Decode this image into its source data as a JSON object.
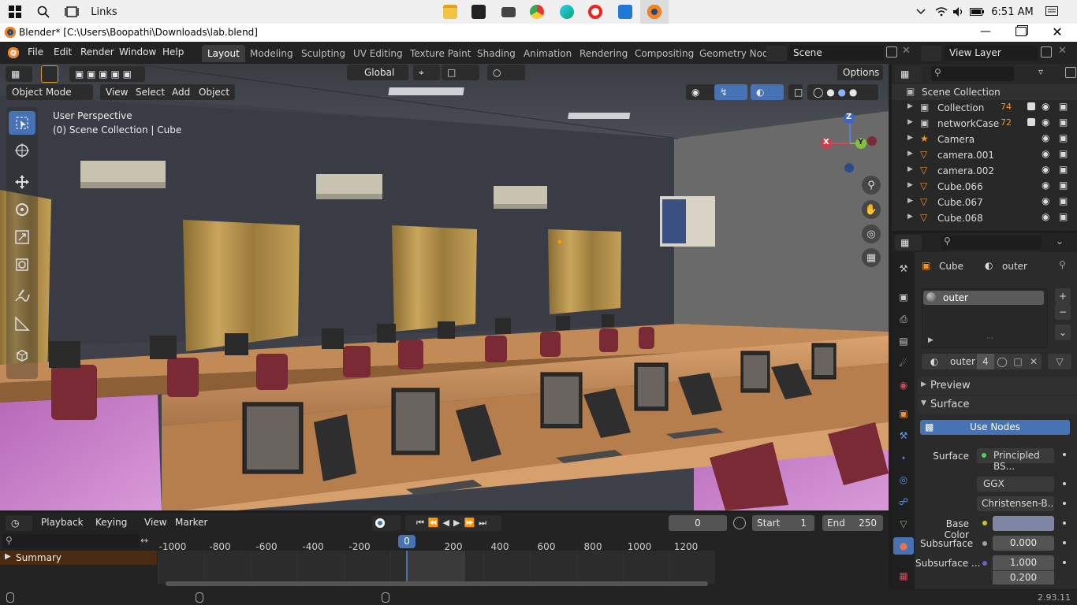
{
  "taskbar": {
    "links_label": "Links",
    "time": "6:51 AM"
  },
  "window": {
    "title": "Blender* [C:\\Users\\Boopathi\\Downloads\\lab.blend]"
  },
  "menu": {
    "file": "File",
    "edit": "Edit",
    "render": "Render",
    "window": "Window",
    "help": "Help"
  },
  "workspaces": [
    "Layout",
    "Modeling",
    "Sculpting",
    "UV Editing",
    "Texture Paint",
    "Shading",
    "Animation",
    "Rendering",
    "Compositing",
    "Geometry Nod"
  ],
  "scene": {
    "scene_name": "Scene",
    "view_layer": "View Layer"
  },
  "viewport": {
    "transform_orientation": "Global",
    "options_label": "Options",
    "mode": "Object Mode",
    "view": "View",
    "select": "Select",
    "add": "Add",
    "object": "Object",
    "perspective_label": "User Perspective",
    "context_label": "(0) Scene Collection | Cube",
    "gizmo": {
      "x": "X",
      "y": "Y",
      "z": "Z"
    }
  },
  "timeline": {
    "playback": "Playback",
    "keying": "Keying",
    "view": "View",
    "marker": "Marker",
    "current_frame": "0",
    "start_label": "Start",
    "start_value": "1",
    "end_label": "End",
    "end_value": "250",
    "ticks": [
      "-1000",
      "-800",
      "-600",
      "-400",
      "-200",
      "0",
      "200",
      "400",
      "600",
      "800",
      "1000",
      "1200"
    ],
    "playhead": "0",
    "summary": "Summary"
  },
  "outliner": {
    "root": "Scene Collection",
    "items": [
      {
        "name": "Collection",
        "badge": "74"
      },
      {
        "name": "networkCase",
        "badge": "72"
      },
      {
        "name": "Camera",
        "badge": ""
      },
      {
        "name": "camera.001",
        "badge": ""
      },
      {
        "name": "camera.002",
        "badge": ""
      },
      {
        "name": "Cube.066",
        "badge": ""
      },
      {
        "name": "Cube.067",
        "badge": ""
      },
      {
        "name": "Cube.068",
        "badge": ""
      }
    ]
  },
  "properties": {
    "object_name": "Cube",
    "material_name": "outer",
    "slot_name": "outer",
    "material_field": "outer",
    "user_count": "4",
    "preview_label": "Preview",
    "surface_label": "Surface",
    "use_nodes": "Use Nodes",
    "surface_field_label": "Surface",
    "surface_value": "Principled BS...",
    "distribution": "GGX",
    "subsurface_method": "Christensen-B...",
    "base_color_label": "Base Color",
    "base_color": "#7f86a3",
    "subsurface_label": "Subsurface",
    "subsurface_value": "0.000",
    "subsurface_radius_label": "Subsurface ...",
    "subsurface_radius_1": "1.000",
    "subsurface_radius_2": "0.200"
  },
  "status": {
    "version": "2.93.11"
  }
}
